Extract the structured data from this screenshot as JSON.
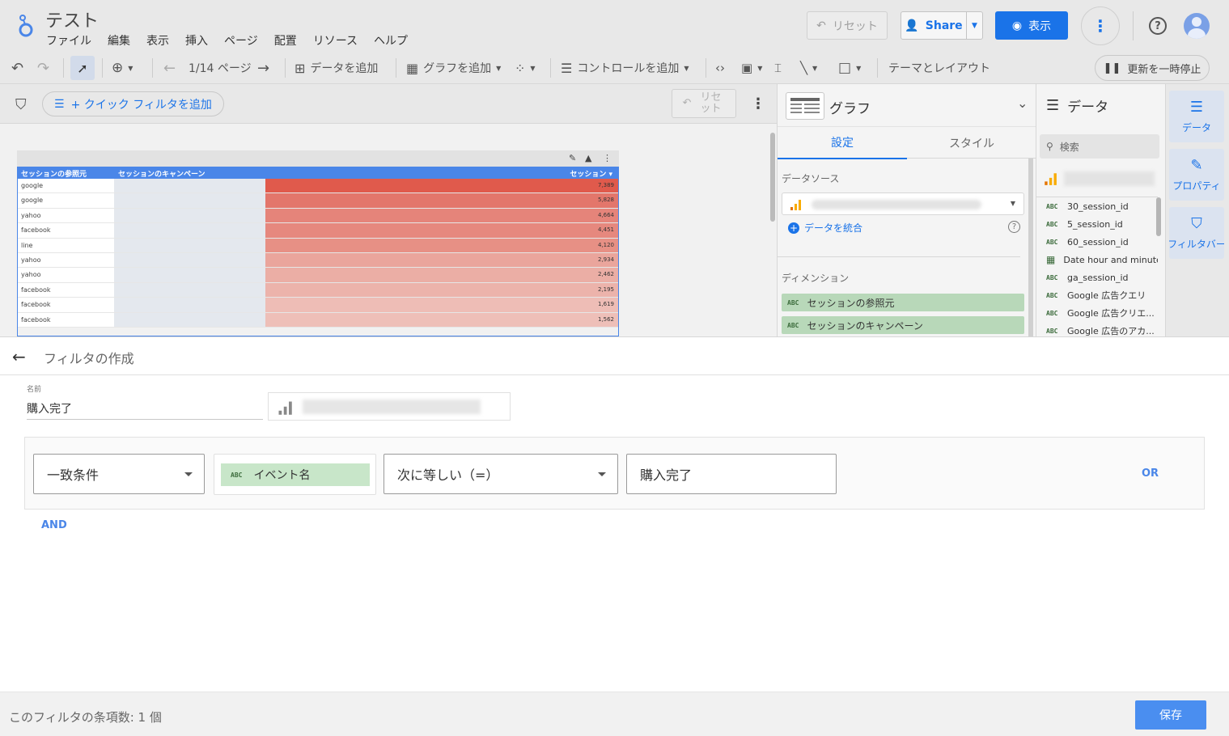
{
  "header": {
    "title": "テスト",
    "menu": [
      "ファイル",
      "編集",
      "表示",
      "挿入",
      "ページ",
      "配置",
      "リソース",
      "ヘルプ"
    ],
    "reset_label": "リセット",
    "share_label": "Share",
    "view_label": "表示"
  },
  "toolbar": {
    "page_indicator": "1/14 ページ",
    "add_data": "データを追加",
    "add_chart": "グラフを追加",
    "add_control": "コントロールを追加",
    "theme_layout": "テーマとレイアウト",
    "pause_updates": "更新を一時停止"
  },
  "filterbar": {
    "quick_filter": "+ クイック フィルタを追加",
    "reset_line1": "リセ",
    "reset_line2": "ット"
  },
  "table": {
    "headers": [
      "セッションの参照元",
      "セッションのキャンペーン",
      "セッション ▾"
    ],
    "rows": [
      {
        "source": "google",
        "value": "7,389",
        "color": "#e05a4c"
      },
      {
        "source": "google",
        "value": "5,828",
        "color": "#e3766b"
      },
      {
        "source": "yahoo",
        "value": "4,664",
        "color": "#e5847a"
      },
      {
        "source": "facebook",
        "value": "4,451",
        "color": "#e6887e"
      },
      {
        "source": "line",
        "value": "4,120",
        "color": "#e79085"
      },
      {
        "source": "yahoo",
        "value": "2,934",
        "color": "#eaa59c"
      },
      {
        "source": "yahoo",
        "value": "2,462",
        "color": "#ebaea5"
      },
      {
        "source": "facebook",
        "value": "2,195",
        "color": "#ecb3ab"
      },
      {
        "source": "facebook",
        "value": "1,619",
        "color": "#eebdb6"
      },
      {
        "source": "facebook",
        "value": "1,562",
        "color": "#eebfb8"
      }
    ]
  },
  "chart_panel": {
    "title": "グラフ",
    "tabs": [
      "設定",
      "スタイル"
    ],
    "datasource_label": "データソース",
    "blend_label": "データを統合",
    "dimension_label": "ディメンション",
    "dimensions": [
      "セッションの参照元",
      "セッションのキャンペーン"
    ]
  },
  "data_panel": {
    "title": "データ",
    "search_placeholder": "検索",
    "fields": [
      {
        "type": "ABC",
        "name": "30_session_id"
      },
      {
        "type": "ABC",
        "name": "5_session_id"
      },
      {
        "type": "ABC",
        "name": "60_session_id"
      },
      {
        "type": "date",
        "name": "Date hour and minute"
      },
      {
        "type": "ABC",
        "name": "ga_session_id"
      },
      {
        "type": "ABC",
        "name": "Google 広告クエリ"
      },
      {
        "type": "ABC",
        "name": "Google 広告クリエ..."
      },
      {
        "type": "ABC",
        "name": "Google 広告のアカ..."
      }
    ]
  },
  "side_tabs": [
    "データ",
    "プロパティ",
    "フィルタバー"
  ],
  "filter_editor": {
    "title": "フィルタの作成",
    "name_label": "名前",
    "name_value": "購入完了",
    "match_type": "一致条件",
    "field_type": "ABC",
    "field_name": "イベント名",
    "operator": "次に等しい（=）",
    "value": "購入完了",
    "or_label": "OR",
    "and_label": "AND",
    "count_text": "このフィルタの条項数: 1 個",
    "save_label": "保存"
  },
  "colors": {
    "accent": "#1a73e8",
    "table_header": "#4a86e8",
    "dimension_chip": "#b8d8b9"
  }
}
